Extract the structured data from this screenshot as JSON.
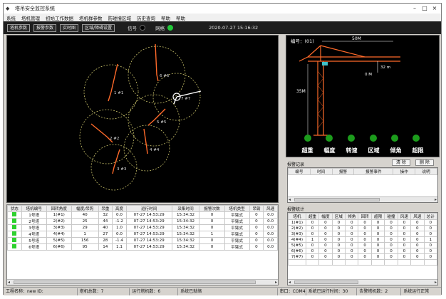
{
  "window": {
    "title": "塔吊安全监控系统",
    "buttons": [
      "–",
      "□",
      "×"
    ]
  },
  "menu": [
    "系统",
    "塔机管理",
    "初始工作数据",
    "塔机群参数",
    "防碰撞区域",
    "历史查询",
    "帮助",
    "帮助"
  ],
  "toolbar": {
    "buttons": [
      "塔机参数",
      "报警参数",
      "实时图",
      "区域/障碍设置"
    ],
    "signal_label": "信号",
    "signal_color": "#000000",
    "comm_label": "网络",
    "comm_color": "#22c93a",
    "datetime": "2020-07-27 15:16:32"
  },
  "cranes": [
    {
      "id": "1 #1",
      "color": "#ff6a2a"
    },
    {
      "id": "2 #2",
      "color": "#ff6a2a"
    },
    {
      "id": "3 #3",
      "color": "#ff6a2a"
    },
    {
      "id": "4 #4",
      "color": "#ff6a2a"
    },
    {
      "id": "5 #5",
      "color": "#ff6a2a"
    },
    {
      "id": "6 #6",
      "color": "#ff6a2a"
    },
    {
      "id": "7 #7",
      "color": "#ffffff"
    }
  ],
  "crane_view": {
    "label": "编号：(01)",
    "jib_length": "50M",
    "height": "35M",
    "trolley": "0 M",
    "load": "32 m",
    "lamps": [
      "超重",
      "幅度",
      "转速",
      "区域",
      "倾角",
      "超限"
    ],
    "lamp_color": "#1c9c1c"
  },
  "alarm": {
    "title": "报警记录",
    "buttons": [
      "清 除",
      "删 除"
    ],
    "columns": [
      "编号",
      "时间",
      "报警",
      "报警事件",
      "操作",
      "说明"
    ]
  },
  "monitor": {
    "columns": [
      "状态",
      "塔机编号",
      "回转角度",
      "幅度/吊钩",
      "吊重",
      "高度",
      "运行时间",
      "采集时间",
      "报警次数",
      "塔机类型",
      "吊臂",
      "风速"
    ],
    "rows": [
      [
        "",
        "1号塔",
        "1(#1)",
        "40",
        "32",
        "0.0",
        "07-27 14:53:29",
        "15:34:32",
        "0",
        "平臂式",
        "0",
        "0.0"
      ],
      [
        "",
        "2号塔",
        "2(#2)",
        "25",
        "44",
        "-1.2",
        "07-27 14:53:29",
        "15:34:32",
        "0",
        "平臂式",
        "0",
        "0.0"
      ],
      [
        "",
        "3号塔",
        "3(#3)",
        "29",
        "40",
        "1.0",
        "07-27 14:53:29",
        "15:34:32",
        "0",
        "平臂式",
        "0",
        "0.0"
      ],
      [
        "",
        "4号塔",
        "4(#4)",
        "1",
        "27",
        "0.0",
        "07-27 14:53:29",
        "15:34:32",
        "1",
        "平臂式",
        "0",
        "0.0"
      ],
      [
        "",
        "5号塔",
        "5(#5)",
        "156",
        "28",
        "-1.4",
        "07-27 14:53:29",
        "15:34:32",
        "0",
        "平臂式",
        "0",
        "0.0"
      ],
      [
        "",
        "6号塔",
        "6(#6)",
        "95",
        "14",
        "1.1",
        "07-27 14:53:29",
        "15:34:32",
        "0",
        "平臂式",
        "0",
        "0.0"
      ]
    ],
    "status_color": "#2ed12e"
  },
  "stats": {
    "title": "报警统计",
    "columns": [
      "塔机",
      "超重",
      "幅度",
      "区域",
      "倾角",
      "回转",
      "超限",
      "碰撞",
      "风速",
      "风速",
      "总计"
    ],
    "rows": [
      [
        "1(#1)",
        "0",
        "0",
        "0",
        "0",
        "0",
        "0",
        "0",
        "0",
        "0",
        "0"
      ],
      [
        "2(#2)",
        "0",
        "0",
        "0",
        "0",
        "0",
        "0",
        "0",
        "0",
        "0",
        "0"
      ],
      [
        "3(#3)",
        "0",
        "0",
        "0",
        "0",
        "0",
        "0",
        "0",
        "0",
        "0",
        "0"
      ],
      [
        "4(#4)",
        "1",
        "0",
        "0",
        "0",
        "0",
        "0",
        "0",
        "0",
        "0",
        "1"
      ],
      [
        "5(#5)",
        "0",
        "0",
        "0",
        "0",
        "0",
        "0",
        "0",
        "0",
        "0",
        "0"
      ],
      [
        "6(#6)",
        "0",
        "0",
        "0",
        "0",
        "0",
        "0",
        "0",
        "0",
        "0",
        "0"
      ],
      [
        "7(#7)",
        "0",
        "0",
        "0",
        "0",
        "0",
        "0",
        "0",
        "0",
        "0",
        "0"
      ],
      [
        "",
        "",
        "",
        "",
        "",
        "",
        "",
        "",
        "",
        "",
        ""
      ]
    ]
  },
  "status": {
    "items": [
      "工程名称：new ID:",
      "塔机总数：7",
      "运行塔机数：6",
      "系统已就绪",
      "串口：COM4",
      "系统已运行时间：30",
      "告警塔机数：2",
      "系统运行正常"
    ]
  }
}
